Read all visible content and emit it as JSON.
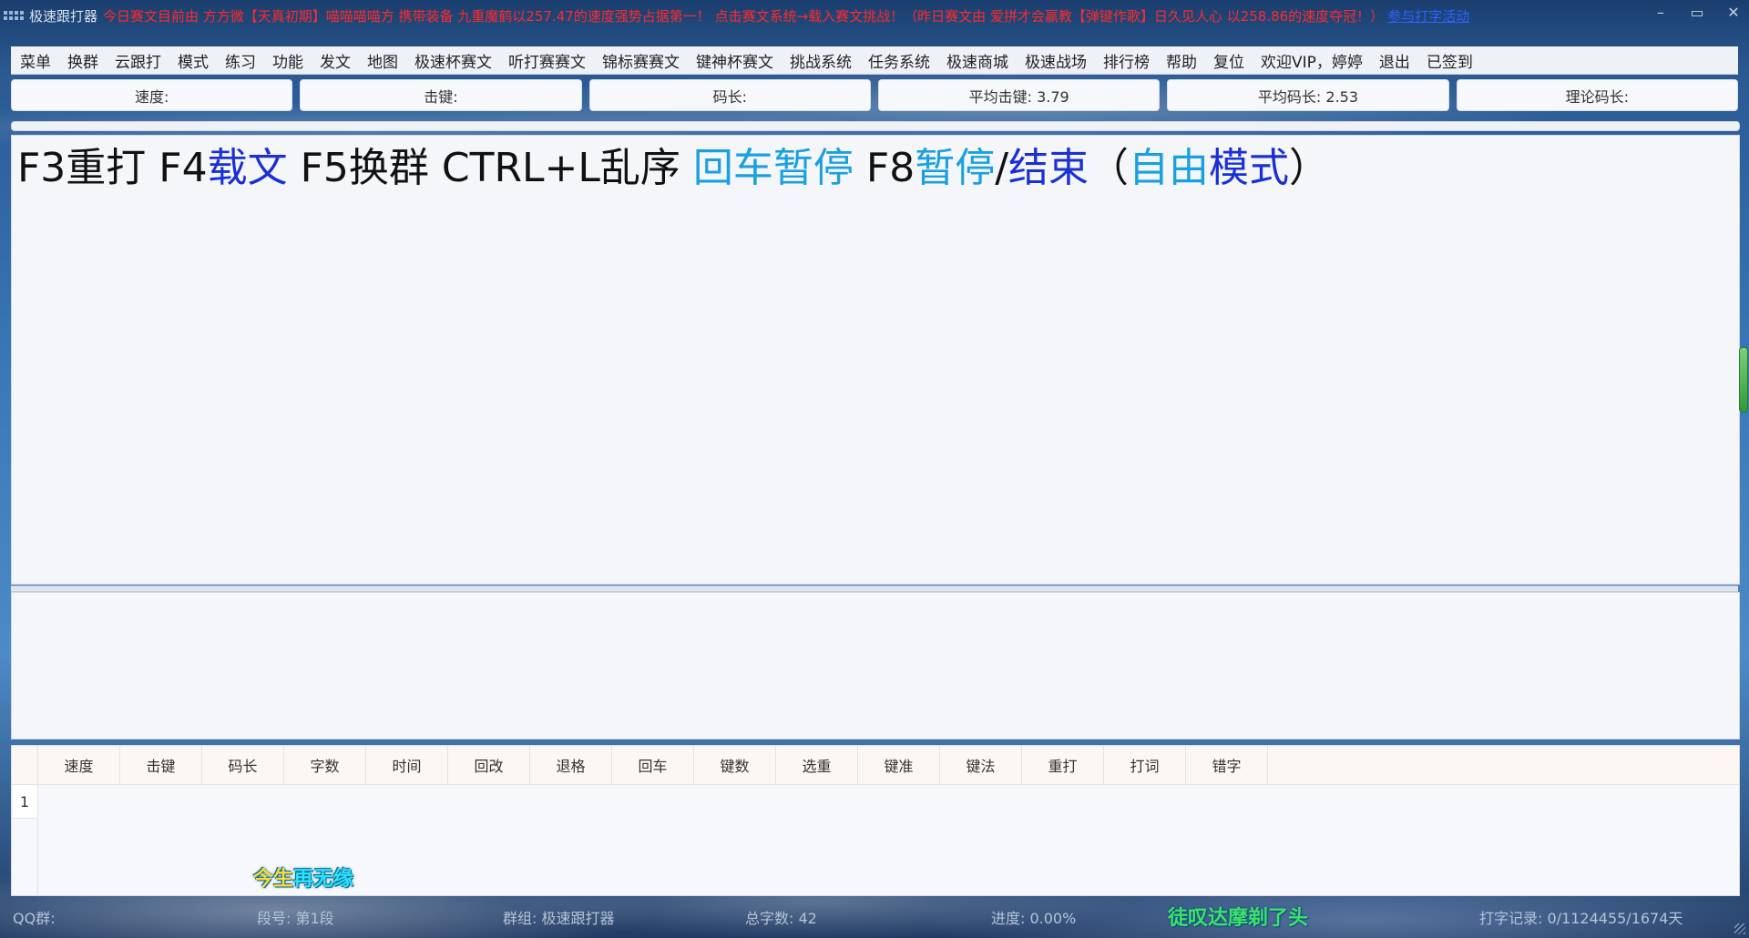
{
  "titlebar": {
    "app_title": "极速跟打器",
    "marquee": "今日赛文目前由 方方微【天真初期】喵喵喵喵方 携带装备 九重魔鹤以257.47的速度强势占据第一！ 点击赛文系统→载入赛文挑战！（昨日赛文由 爱拼才会赢教【弹键作歌】日久见人心 以258.86的速度夺冠！）",
    "marquee_link": "参与打字活动",
    "minimize": "–",
    "restore": "▭",
    "close": "✕"
  },
  "menu": [
    "菜单",
    "换群",
    "云跟打",
    "模式",
    "练习",
    "功能",
    "发文",
    "地图",
    "极速杯赛文",
    "听打赛赛文",
    "锦标赛赛文",
    "键神杯赛文",
    "挑战系统",
    "任务系统",
    "极速商城",
    "极速战场",
    "排行榜",
    "帮助",
    "复位",
    "欢迎VIP，婷婷",
    "退出",
    "已签到"
  ],
  "stats": {
    "speed": "速度:",
    "keystroke": "击键:",
    "code_length": "码长:",
    "avg_keystroke": "平均击键: 3.79",
    "avg_code_length": "平均码长: 2.53",
    "theory_code_length": "理论码长:"
  },
  "prompt": {
    "p1": "F3重打 F4",
    "p2": "载文",
    "p3": " F5换群 CTRL+L乱序 ",
    "p4": "回车暂停",
    "p5": " F8",
    "p6": "暂停",
    "p7": "/",
    "p8": "结束",
    "p9": "（",
    "p10": "自由",
    "p11": "模式",
    "p12": "）"
  },
  "table": {
    "headers": [
      "速度",
      "击键",
      "码长",
      "字数",
      "时间",
      "回改",
      "退格",
      "回车",
      "键数",
      "选重",
      "键准",
      "键法",
      "重打",
      "打词",
      "错字"
    ],
    "row_number": "1"
  },
  "song_left": {
    "a": "今生",
    "b": "再无缘"
  },
  "song_right": "徒叹达摩剃了头",
  "status": {
    "qq_group": "QQ群:",
    "segment": "段号: 第1段",
    "group": "群组: 极速跟打器",
    "total_chars": "总字数: 42",
    "progress": "进度: 0.00%",
    "record": "打字记录: 0/1124455/1674天"
  },
  "colors": {
    "marquee": "#ff2a2a",
    "link": "#2a64ff",
    "hint_blue": "#1a2fd6",
    "hint_cyan": "#1aa0e0"
  }
}
